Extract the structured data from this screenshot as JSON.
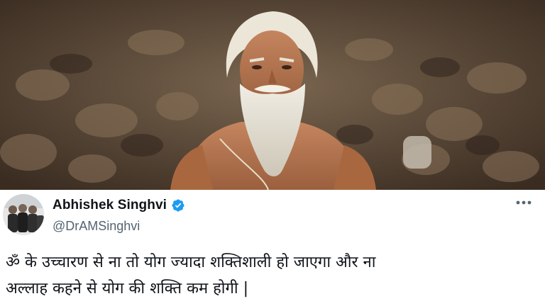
{
  "photo": {
    "description_icon": "portrait-photo"
  },
  "tweet": {
    "display_name": "Abhishek Singhvi",
    "handle": "@DrAMSinghvi",
    "verified_icon": "verified-badge-icon",
    "more_icon": "more-options-icon",
    "text_line_1": "ॐ के उच्चारण से ना तो योग ज्यादा शक्तिशाली हो जाएगा और ना",
    "text_line_2": "अल्लाह कहने से योग की शक्ति कम होगी |"
  },
  "colors": {
    "verified": "#1d9bf0",
    "text": "#0f1419",
    "secondary": "#536471"
  }
}
